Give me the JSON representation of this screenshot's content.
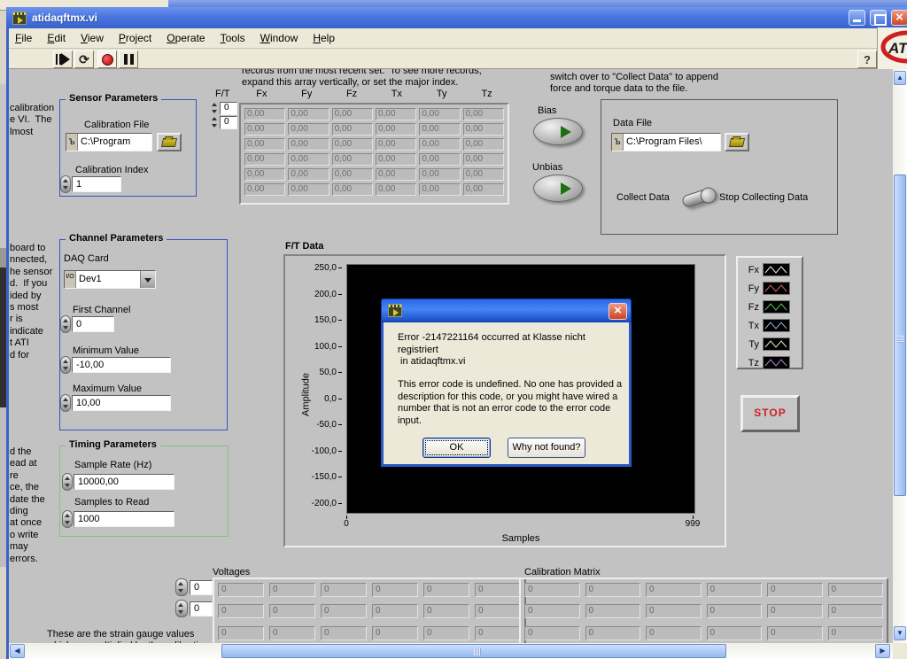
{
  "window": {
    "title": "atidaqftmx.vi"
  },
  "menu": {
    "items": [
      "File",
      "Edit",
      "View",
      "Project",
      "Operate",
      "Tools",
      "Window",
      "Help"
    ]
  },
  "toolbar": {
    "help_label": "?"
  },
  "logo": {
    "text": "ATI",
    "color": "#cc2020"
  },
  "icons": {
    "path_type": "Ъ",
    "io_type": "I/O"
  },
  "left_text": {
    "group1": [
      "calibration",
      "e VI.  The",
      "lmost"
    ],
    "group2": [
      "board to",
      "nnected,",
      "he sensor",
      "d.  If you",
      "ided by",
      "s most",
      "r is",
      "indicate",
      "t ATI",
      "d for"
    ],
    "group3": [
      "d the",
      "ead at",
      "re",
      "ce, the",
      "date the",
      "ding",
      "at once",
      "o write",
      "may",
      "errors."
    ],
    "bottom": [
      "These are the strain gauge values",
      "which are multiplied by the calibration"
    ]
  },
  "instructions": {
    "array_note": [
      "records from the most recent set.  To see more records,",
      "expand this array vertically, or set the major index."
    ],
    "collect_note": [
      "switch over to \"Collect Data\" to append",
      "force and torque data to the file."
    ]
  },
  "ft_array": {
    "label": "F/T",
    "index_values": [
      "0",
      "0"
    ],
    "headers": [
      "Fx",
      "Fy",
      "Fz",
      "Tx",
      "Ty",
      "Tz"
    ],
    "cells": [
      "0,00",
      "0,00",
      "0,00",
      "0,00",
      "0,00",
      "0,00",
      "0,00",
      "0,00",
      "0,00",
      "0,00",
      "0,00",
      "0,00",
      "0,00",
      "0,00",
      "0,00",
      "0,00",
      "0,00",
      "0,00",
      "0,00",
      "0,00",
      "0,00",
      "0,00",
      "0,00",
      "0,00",
      "0,00",
      "0,00",
      "0,00",
      "0,00",
      "0,00",
      "0,00",
      "0,00",
      "0,00",
      "0,00",
      "0,00",
      "0,00",
      "0,00"
    ]
  },
  "sensor_params": {
    "title": "Sensor Parameters",
    "calibration_file_label": "Calibration File",
    "calibration_file_value": "C:\\Program",
    "calibration_index_label": "Calibration Index",
    "calibration_index_value": "1"
  },
  "channel_params": {
    "title": "Channel Parameters",
    "daq_card_label": "DAQ Card",
    "daq_card_value": "Dev1",
    "first_channel_label": "First Channel",
    "first_channel_value": "0",
    "min_label": "Minimum Value",
    "min_value": "-10,00",
    "max_label": "Maximum Value",
    "max_value": "10,00"
  },
  "timing_params": {
    "title": "Timing Parameters",
    "sample_rate_label": "Sample Rate (Hz)",
    "sample_rate_value": "10000,00",
    "samples_label": "Samples to Read",
    "samples_value": "1000"
  },
  "bias": {
    "bias_label": "Bias",
    "unbias_label": "Unbias"
  },
  "data_file": {
    "label": "Data File",
    "value": "C:\\Program Files\\",
    "collect_label": "Collect Data",
    "stop_label": "Stop Collecting Data"
  },
  "graph": {
    "title": "F/T Data",
    "y_label": "Amplitude",
    "x_label": "Samples",
    "y_ticks": [
      "250,0",
      "200,0",
      "150,0",
      "100,0",
      "50,0",
      "0,0",
      "-50,0",
      "-100,0",
      "-150,0",
      "-200,0"
    ],
    "x_tick_min": "0",
    "x_tick_max": "999"
  },
  "legend": {
    "items": [
      {
        "label": "Fx",
        "color": "#f0f0f0"
      },
      {
        "label": "Fy",
        "color": "#d06868"
      },
      {
        "label": "Fz",
        "color": "#58c858"
      },
      {
        "label": "Tx",
        "color": "#90b4e8"
      },
      {
        "label": "Ty",
        "color": "#e8e8c8"
      },
      {
        "label": "Tz",
        "color": "#b088d8"
      }
    ]
  },
  "stop_button": {
    "label": "STOP"
  },
  "voltages": {
    "label": "Voltages",
    "index_values": [
      "0",
      "0"
    ],
    "cells": [
      "0",
      "0",
      "0",
      "0",
      "0",
      "0",
      "0",
      "0",
      "0",
      "0",
      "0",
      "0",
      "0",
      "0",
      "0",
      "0",
      "0",
      "0"
    ]
  },
  "calibration_matrix": {
    "label": "Calibration Matrix",
    "cells": [
      "0",
      "0",
      "0",
      "0",
      "0",
      "0",
      "0",
      "0",
      "0",
      "0",
      "0",
      "0",
      "0",
      "0",
      "0",
      "0",
      "0",
      "0"
    ]
  },
  "error_dialog": {
    "message_lines": [
      "Error -2147221164 occurred at Klasse nicht",
      "registriert",
      " in atidaqftmx.vi"
    ],
    "detail_lines": [
      "This error code is undefined. No one has provided a",
      "description for this code, or you might have wired a",
      "number that is not an error code to the error code",
      "input."
    ],
    "ok_label": "OK",
    "why_label": "Why not found?"
  }
}
